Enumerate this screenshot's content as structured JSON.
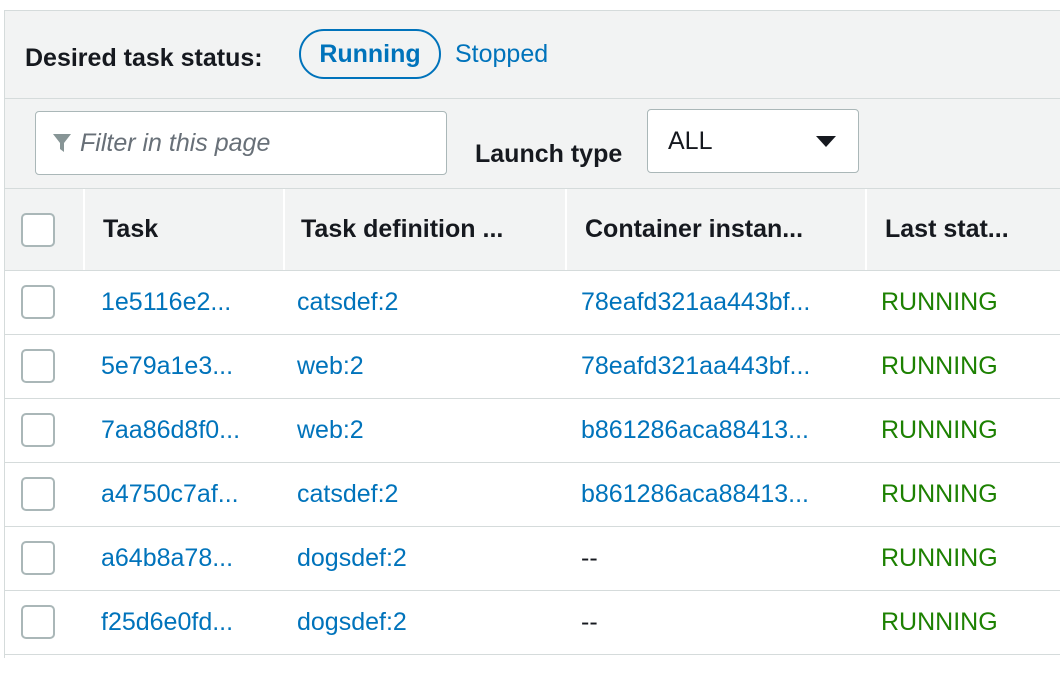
{
  "status_filter": {
    "label": "Desired task status:",
    "options": [
      "Running",
      "Stopped"
    ],
    "selected": "Running"
  },
  "filter": {
    "placeholder": "Filter in this page",
    "icon": "funnel-icon"
  },
  "launch_type": {
    "label": "Launch type",
    "value": "ALL"
  },
  "table": {
    "columns": [
      "Task",
      "Task definition ...",
      "Container instan...",
      "Last stat..."
    ],
    "rows": [
      {
        "task": "1e5116e2...",
        "definition": "catsdef:2",
        "container": "78eafd321aa443bf...",
        "status": "RUNNING"
      },
      {
        "task": "5e79a1e3...",
        "definition": "web:2",
        "container": "78eafd321aa443bf...",
        "status": "RUNNING"
      },
      {
        "task": "7aa86d8f0...",
        "definition": "web:2",
        "container": "b861286aca88413...",
        "status": "RUNNING"
      },
      {
        "task": "a4750c7af...",
        "definition": "catsdef:2",
        "container": "b861286aca88413...",
        "status": "RUNNING"
      },
      {
        "task": "a64b8a78...",
        "definition": "dogsdef:2",
        "container": "--",
        "status": "RUNNING"
      },
      {
        "task": "f25d6e0fd...",
        "definition": "dogsdef:2",
        "container": "--",
        "status": "RUNNING"
      }
    ]
  },
  "colors": {
    "link": "#0073bb",
    "running": "#1d8102",
    "header_bg": "#f2f3f3"
  }
}
